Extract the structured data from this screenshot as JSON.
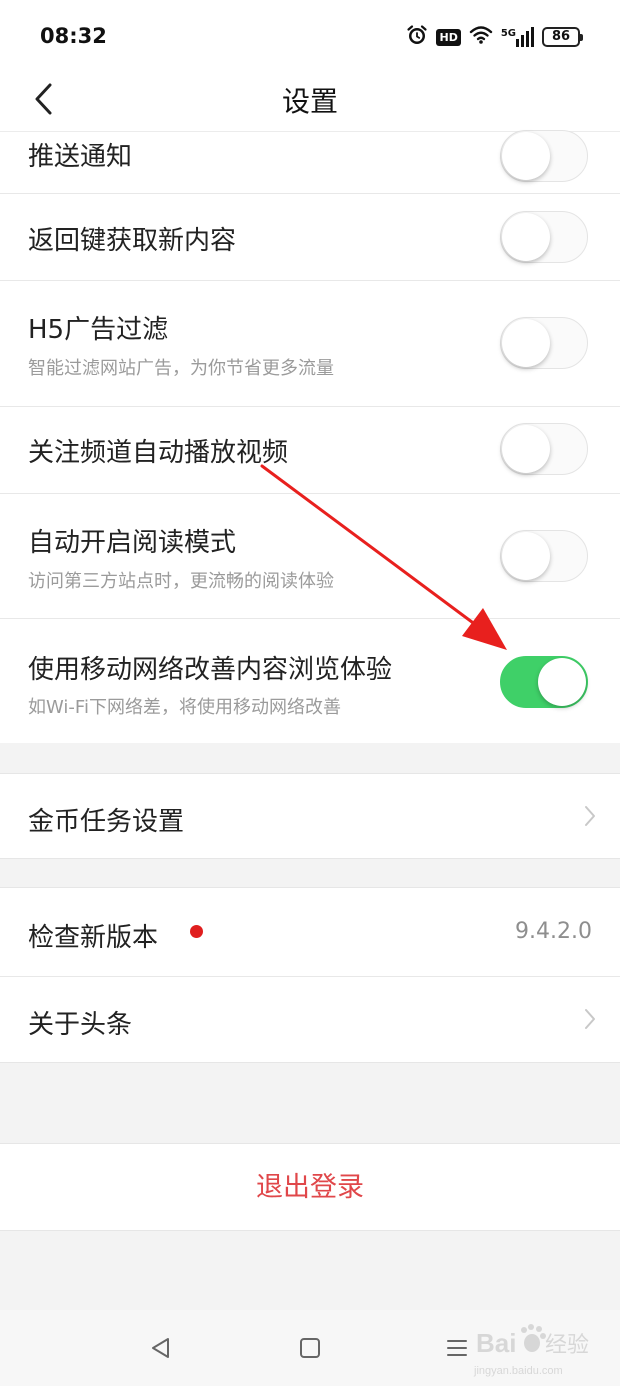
{
  "status_bar": {
    "time": "08:32",
    "icons": [
      "alarm-icon",
      "hd-icon",
      "wifi-icon",
      "5g-signal-icon",
      "battery-icon"
    ],
    "hd_label": "HD",
    "network_label": "5G",
    "battery": "86"
  },
  "nav": {
    "title": "设置",
    "back_icon": "chevron-left-icon"
  },
  "toggle_settings": [
    {
      "title": "推送通知",
      "subtitle": "",
      "enabled": false
    },
    {
      "title": "返回键获取新内容",
      "subtitle": "",
      "enabled": false
    },
    {
      "title": "H5广告过滤",
      "subtitle": "智能过滤网站广告，为你节省更多流量",
      "enabled": false
    },
    {
      "title": "关注频道自动播放视频",
      "subtitle": "",
      "enabled": false
    },
    {
      "title": "自动开启阅读模式",
      "subtitle": "访问第三方站点时，更流畅的阅读体验",
      "enabled": false
    },
    {
      "title": "使用移动网络改善内容浏览体验",
      "subtitle": "如Wi-Fi下网络差，将使用移动网络改善",
      "enabled": true
    }
  ],
  "coin_settings": {
    "label": "金币任务设置"
  },
  "check_update": {
    "label": "检查新版本",
    "version": "9.4.2.0"
  },
  "about": {
    "label": "关于头条"
  },
  "logout": {
    "label": "退出登录"
  },
  "system_nav": [
    "back-triangle-icon",
    "home-square-icon",
    "menu-lines-icon"
  ],
  "colors": {
    "toggle_on": "#3fd068",
    "logout_text": "#e0474a",
    "red_dot": "#e01e1e",
    "annotation_arrow": "#e8201e"
  }
}
